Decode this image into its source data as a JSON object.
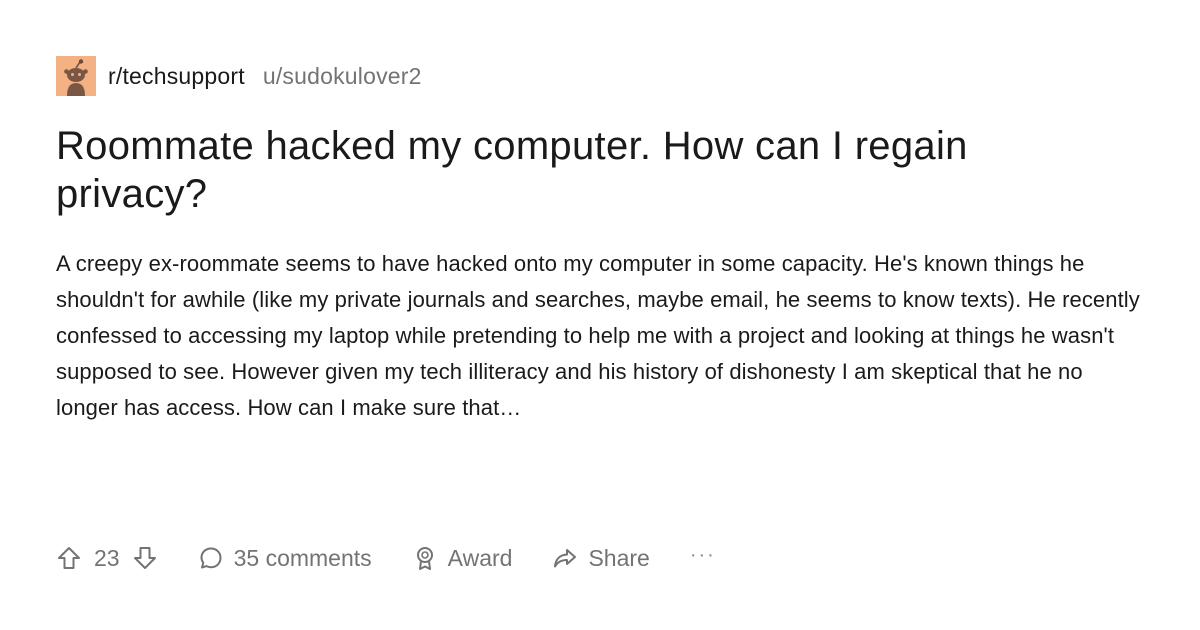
{
  "post": {
    "subreddit": "r/techsupport",
    "username": "u/sudokulover2",
    "avatar_icon": "reddit-snoo-icon",
    "title": "Roommate hacked my computer. How can I regain privacy?",
    "body": "A creepy ex-roommate  seems to have hacked onto my computer in some capacity. He's known things he shouldn't for awhile (like my private journals and searches, maybe email, he seems to know texts). He recently confessed to accessing my laptop while pretending to help me with a project and looking at things he wasn't supposed to see. However given my tech illiteracy and his history of dishonesty I am skeptical that he no longer has access. How can I make sure that…"
  },
  "actions": {
    "vote_count": "23",
    "comments_label": "35 comments",
    "award_label": "Award",
    "share_label": "Share",
    "more_label": "···"
  },
  "colors": {
    "text": "#1a1a1b",
    "muted": "#737373",
    "avatar_bg": "#f4b183"
  }
}
